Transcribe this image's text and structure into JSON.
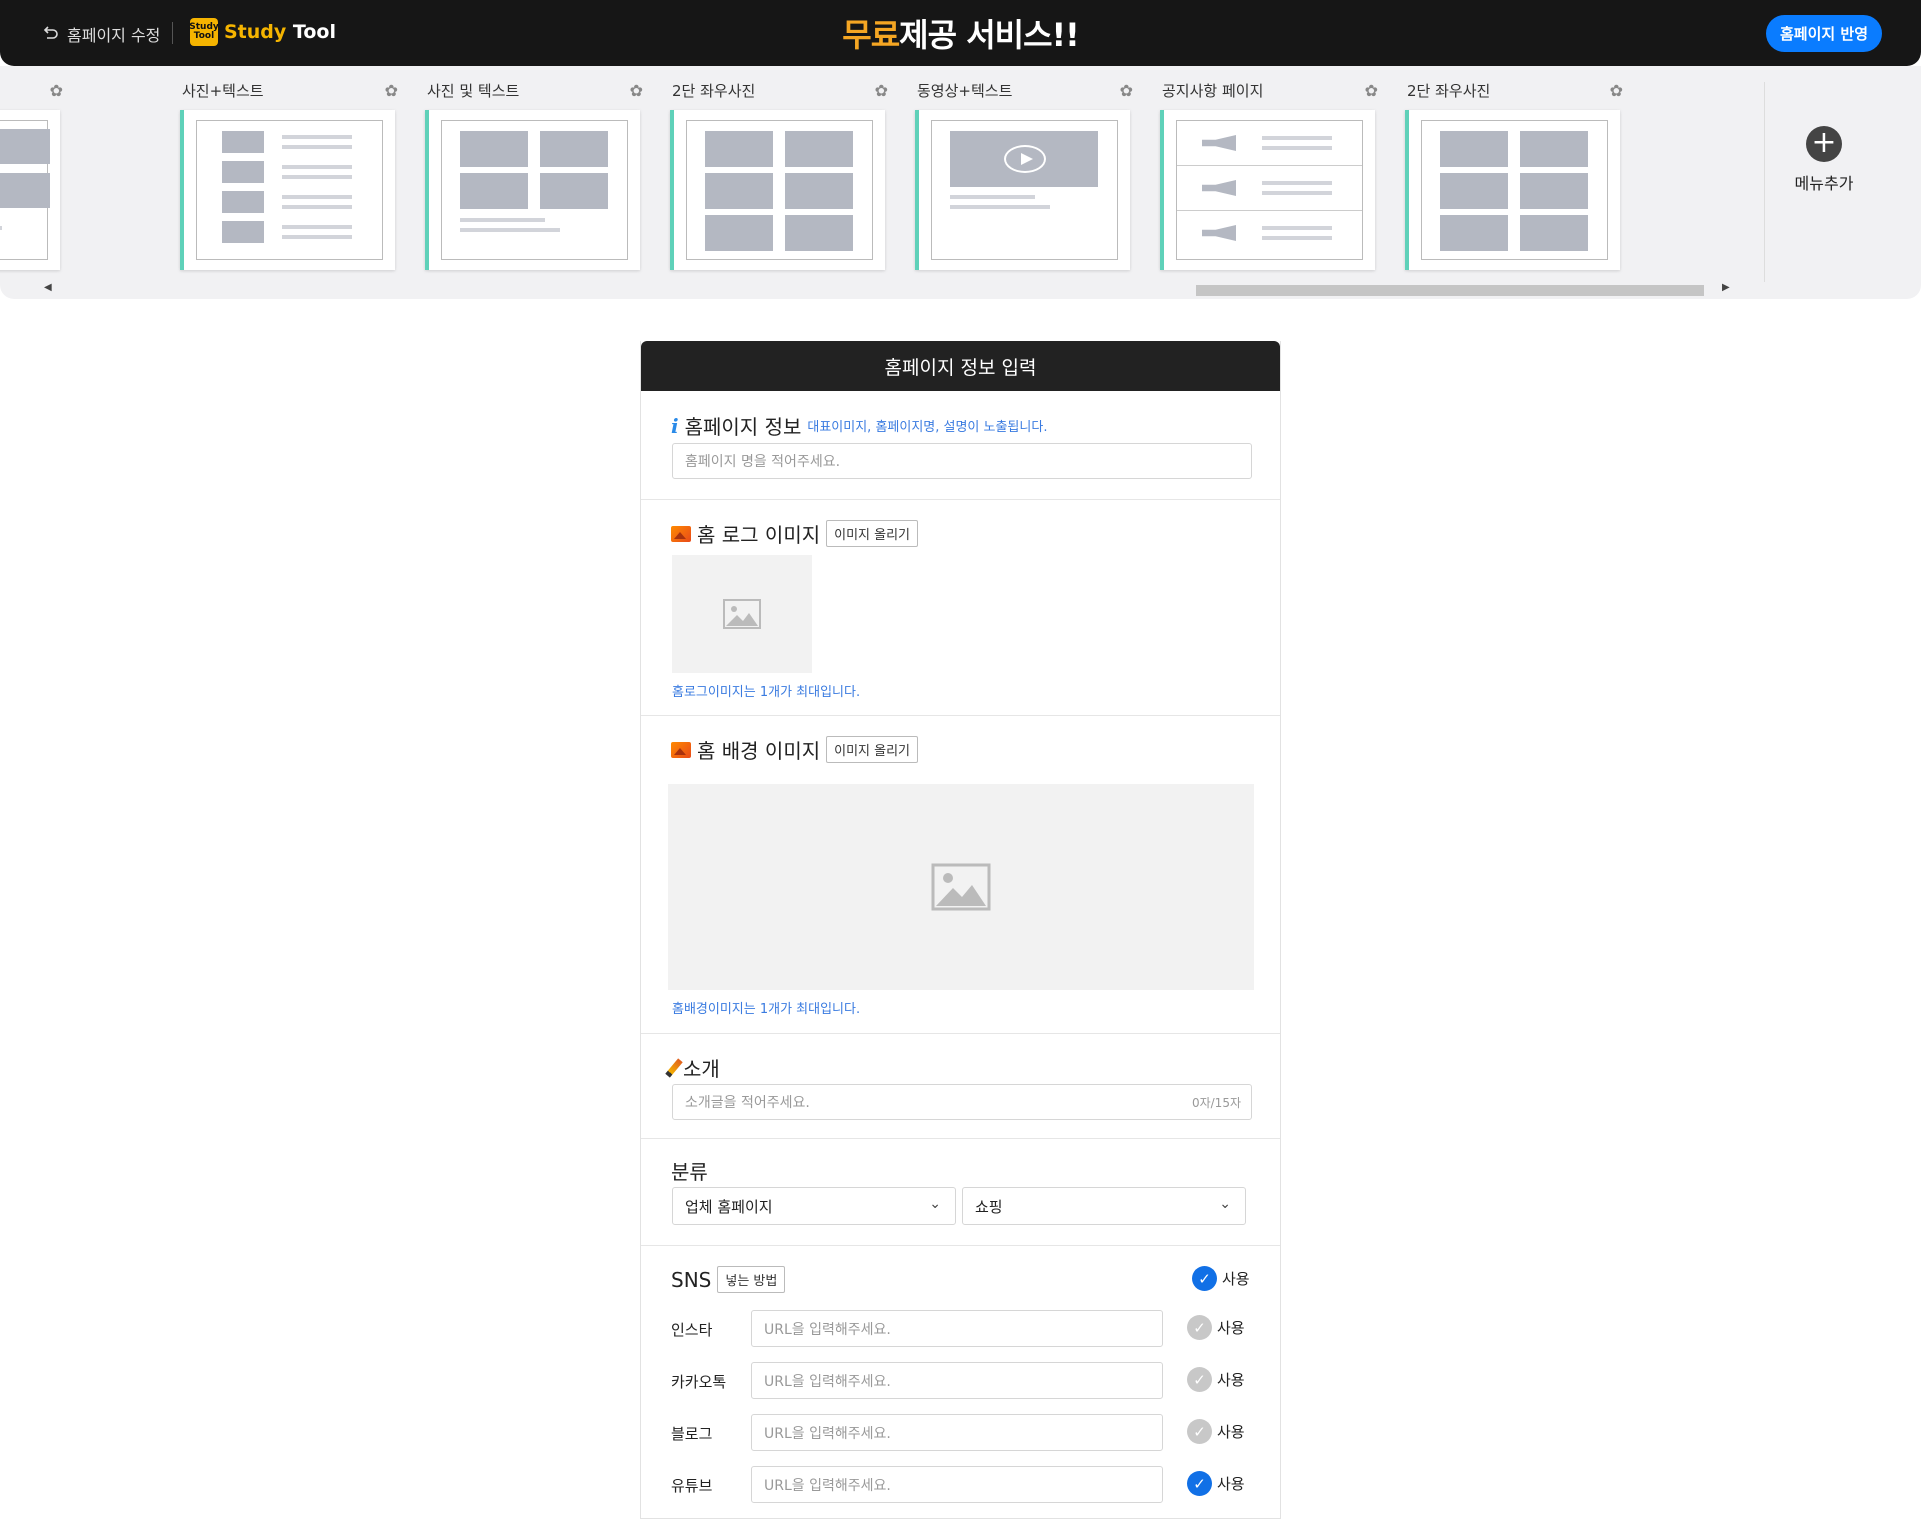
{
  "header": {
    "back_label": "홈페이지 수정",
    "logo_box": "Study Tool",
    "logo_study": "Study",
    "logo_tool": " Tool",
    "banner_highlight": "무료",
    "banner_rest": "제공 서비스!!",
    "publish_label": "홈페이지 반영"
  },
  "templates": [
    {
      "name": "사진+텍스트"
    },
    {
      "name": "사진 및 텍스트"
    },
    {
      "name": "2단 좌우사진"
    },
    {
      "name": "동영상+텍스트"
    },
    {
      "name": "공지사항 페이지"
    },
    {
      "name": "2단 좌우사진"
    }
  ],
  "add_menu_label": "메뉴추가",
  "form": {
    "title": "홈페이지 정보 입력",
    "info": {
      "title": "홈페이지 정보",
      "hint": "대표이미지, 홈페이지명, 설명이 노출됩니다.",
      "placeholder": "홈페이지 명을 적어주세요."
    },
    "logo": {
      "title": "홈 로그 이미지",
      "upload_label": "이미지 올리기",
      "note": "홈로그이미지는 1개가 최대입니다."
    },
    "background": {
      "title": "홈 배경 이미지",
      "upload_label": "이미지 올리기",
      "note": "홈배경이미지는 1개가 최대입니다."
    },
    "intro": {
      "title": "소개",
      "placeholder": "소개글을 적어주세요.",
      "counter": "0자/15자"
    },
    "category": {
      "title": "분류",
      "select1": "업체 홈페이지",
      "select2": "쇼핑"
    },
    "sns": {
      "title": "SNS",
      "howto_label": "넣는 방법",
      "use_label": "사용",
      "use_checked": true,
      "rows": [
        {
          "label": "인스타",
          "placeholder": "URL을 입력해주세요.",
          "use_label": "사용",
          "checked": false
        },
        {
          "label": "카카오톡",
          "placeholder": "URL을 입력해주세요.",
          "use_label": "사용",
          "checked": false
        },
        {
          "label": "블로그",
          "placeholder": "URL을 입력해주세요.",
          "use_label": "사용",
          "checked": false
        },
        {
          "label": "유튜브",
          "placeholder": "URL을 입력해주세요.",
          "use_label": "사용",
          "checked": true
        }
      ]
    }
  },
  "colors": {
    "accent": "#0a7cff",
    "card_border": "#5fd1b9",
    "banner_highlight": "#f5a623",
    "hint": "#3a7be0"
  }
}
